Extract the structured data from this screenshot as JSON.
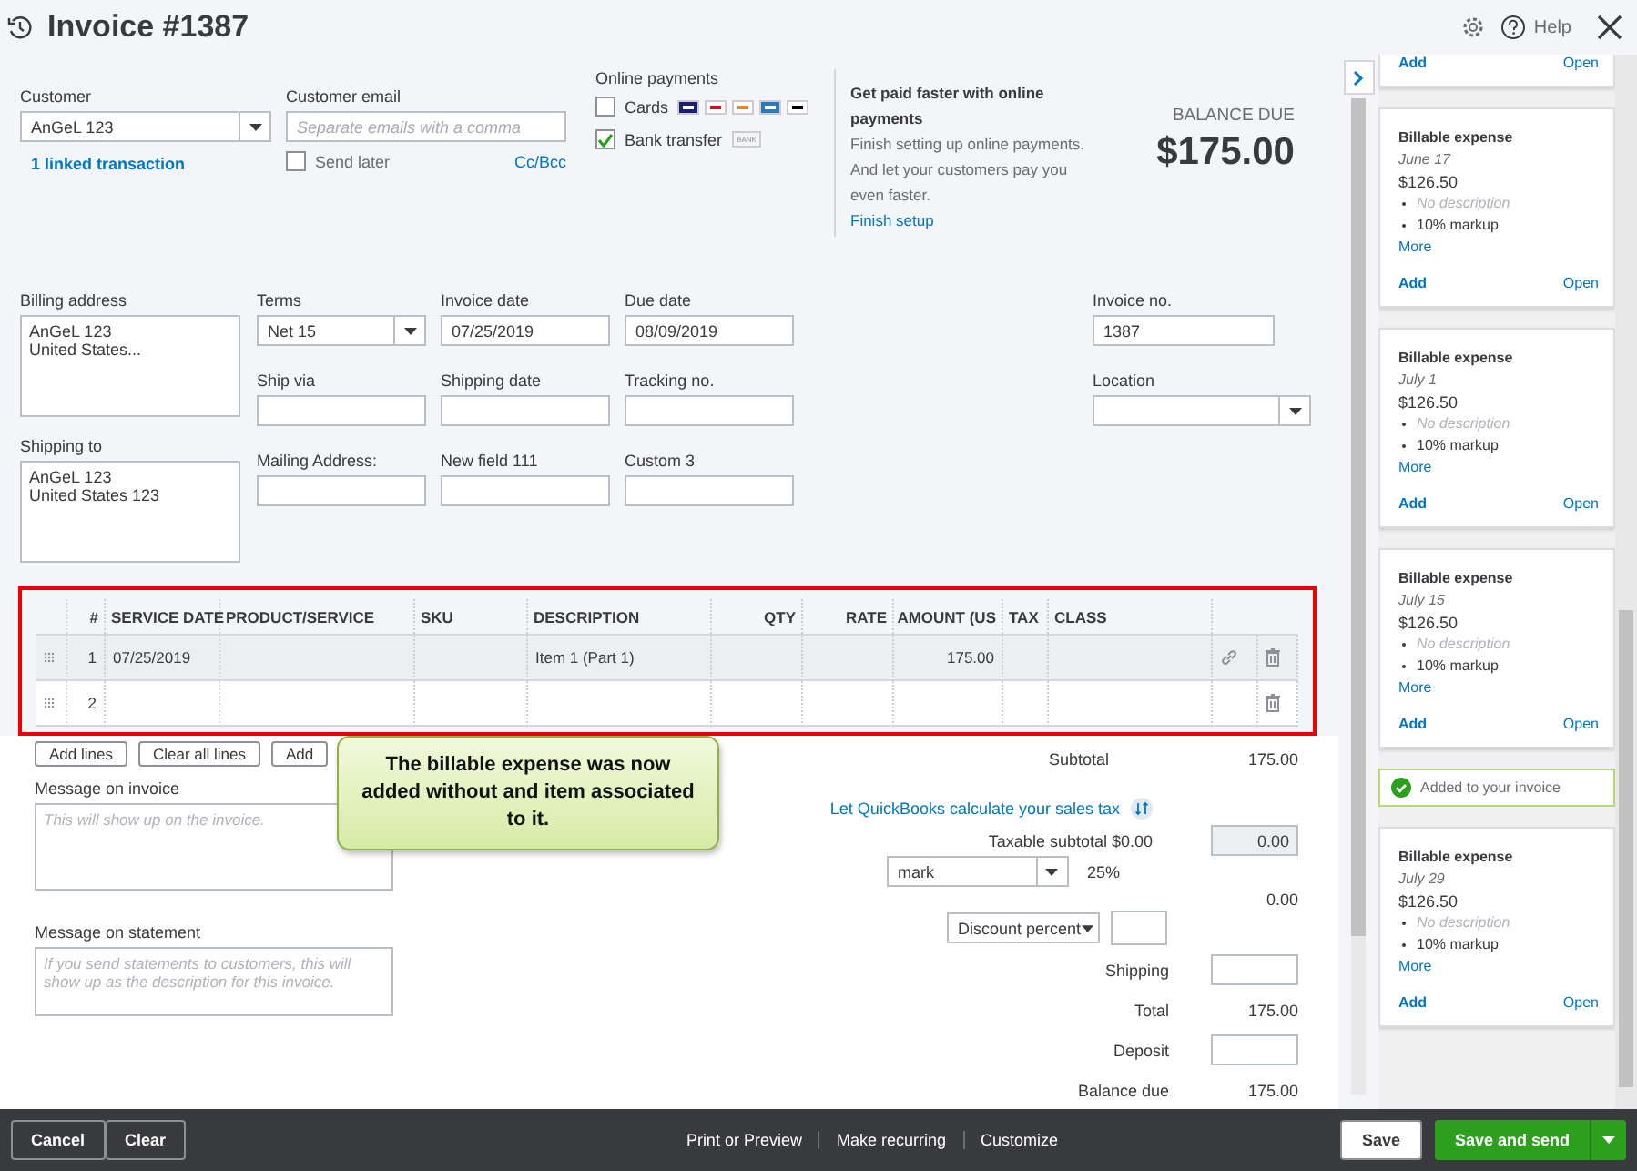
{
  "header": {
    "title": "Invoice #1387",
    "help": "Help"
  },
  "customer": {
    "label": "Customer",
    "value": "AnGeL 123",
    "link": "1 linked transaction"
  },
  "email": {
    "label": "Customer email",
    "placeholder": "Separate emails with a comma",
    "send_later": {
      "label": "Send later",
      "checked": false
    },
    "cc_link": "Cc/Bcc"
  },
  "online_payments": {
    "label": "Online payments",
    "options": [
      {
        "kind": "cards",
        "label": "Cards",
        "checked": false
      },
      {
        "kind": "bank",
        "label": "Bank transfer",
        "checked": true,
        "badge": "BANK"
      }
    ]
  },
  "promo": {
    "title": "Get paid faster with online payments",
    "body": "Finish setting up online payments. And let your customers pay you even faster.",
    "link": "Finish setup"
  },
  "balance": {
    "label": "BALANCE DUE",
    "amount": "$175.00"
  },
  "billing_address": {
    "label": "Billing address",
    "value": "AnGeL 123\nUnited States..."
  },
  "shipping_to": {
    "label": "Shipping to",
    "value": "AnGeL 123\nUnited States 123"
  },
  "fields": [
    {
      "kind": "select",
      "label": "Terms",
      "value": "Net 15"
    },
    {
      "kind": "text",
      "label": "Invoice date",
      "value": "07/25/2019"
    },
    {
      "kind": "text",
      "label": "Due date",
      "value": "08/09/2019"
    },
    {
      "kind": "text",
      "label": "Ship via"
    },
    {
      "kind": "text",
      "label": "Shipping date"
    },
    {
      "kind": "text",
      "label": "Tracking no."
    },
    {
      "kind": "text",
      "label": "Mailing Address:"
    },
    {
      "kind": "text",
      "label": "New field 111"
    },
    {
      "kind": "text",
      "label": "Custom 3"
    }
  ],
  "side_fields": [
    {
      "kind": "text",
      "label": "Invoice no.",
      "value": "1387"
    },
    {
      "kind": "select",
      "label": "Location"
    }
  ],
  "table": {
    "columns": [
      "#",
      "SERVICE DATE",
      "PRODUCT/SERVICE",
      "SKU",
      "DESCRIPTION",
      "QTY",
      "RATE",
      "AMOUNT (US",
      "TAX",
      "CLASS"
    ],
    "rows": [
      {
        "selected": true,
        "linked": true,
        "cells": [
          "1",
          "07/25/2019",
          "",
          "",
          "Item 1 (Part 1)",
          "",
          "",
          "175.00",
          "",
          ""
        ]
      },
      {
        "selected": false,
        "linked": false,
        "cells": [
          "2",
          "",
          "",
          "",
          "",
          "",
          "",
          "",
          "",
          ""
        ]
      }
    ]
  },
  "line_buttons": [
    "Add lines",
    "Clear all lines",
    "Add"
  ],
  "callout": "The billable expense was now added without and item associated to it.",
  "message_on_invoice": {
    "label": "Message on invoice",
    "placeholder": "This will show up on the invoice."
  },
  "message_on_statement": {
    "label": "Message on statement",
    "placeholder": "If you send statements to customers, this will show up as the description for this invoice."
  },
  "totals": {
    "subtotal_label": "Subtotal",
    "subtotal": "175.00",
    "tax_link": "Let QuickBooks calculate your sales tax",
    "taxable_subtotal": "Taxable subtotal $0.00",
    "tax_amount": "0.00",
    "tax_rate": "mark",
    "tax_percent": "25%",
    "tax_total": "0.00",
    "discount_type": "Discount percent",
    "shipping_label": "Shipping",
    "total_label": "Total",
    "total": "175.00",
    "deposit_label": "Deposit",
    "balance_due_label": "Balance due",
    "balance_due": "175.00"
  },
  "footer": {
    "cancel": "Cancel",
    "clear": "Clear",
    "links": [
      "Print or Preview",
      "Make recurring",
      "Customize"
    ],
    "save": "Save",
    "save_and_send": "Save and send"
  },
  "panel": [
    {
      "kind": "partial",
      "add": "Add",
      "open": "Open"
    },
    {
      "kind": "expense",
      "title": "Billable expense",
      "date": "June 17",
      "amount": "$126.50",
      "bullets": [
        {
          "text": "No description",
          "muted": true
        },
        {
          "text": "10% markup",
          "muted": false
        }
      ],
      "more": "More",
      "add": "Add",
      "open": "Open"
    },
    {
      "kind": "expense",
      "title": "Billable expense",
      "date": "July 1",
      "amount": "$126.50",
      "bullets": [
        {
          "text": "No description",
          "muted": true
        },
        {
          "text": "10% markup",
          "muted": false
        }
      ],
      "more": "More",
      "add": "Add",
      "open": "Open"
    },
    {
      "kind": "expense",
      "title": "Billable expense",
      "date": "July 15",
      "amount": "$126.50",
      "bullets": [
        {
          "text": "No description",
          "muted": true
        },
        {
          "text": "10% markup",
          "muted": false
        }
      ],
      "more": "More",
      "add": "Add",
      "open": "Open"
    },
    {
      "kind": "notice",
      "text": "Added to your invoice"
    },
    {
      "kind": "expense",
      "title": "Billable expense",
      "date": "July 29",
      "amount": "$126.50",
      "bullets": [
        {
          "text": "No description",
          "muted": true
        },
        {
          "text": "10% markup",
          "muted": false
        }
      ],
      "more": "More",
      "add": "Add",
      "open": "Open"
    }
  ]
}
